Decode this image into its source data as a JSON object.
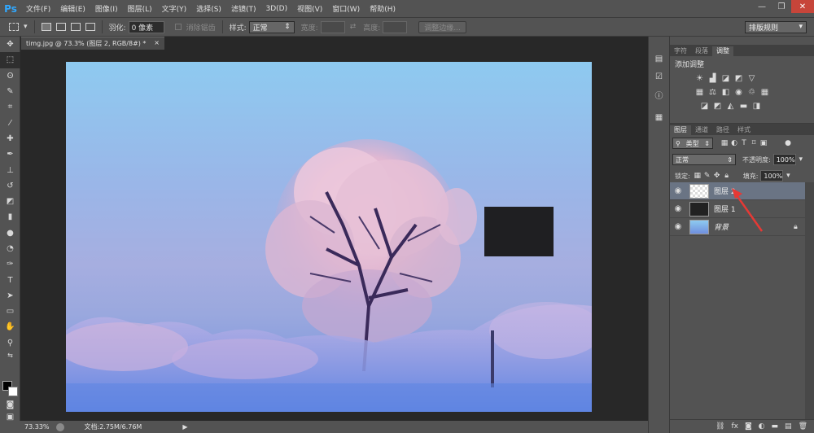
{
  "app": {
    "logo": "Ps"
  },
  "menu": [
    "文件(F)",
    "编辑(E)",
    "图像(I)",
    "图层(L)",
    "文字(Y)",
    "选择(S)",
    "滤镜(T)",
    "3D(D)",
    "视图(V)",
    "窗口(W)",
    "帮助(H)"
  ],
  "window_controls": {
    "minimize": "—",
    "restore": "❐",
    "close": "✕"
  },
  "options": {
    "feather_label": "羽化:",
    "feather_value": "0 像素",
    "antialias_label": "消除锯齿",
    "style_label": "样式:",
    "style_value": "正常",
    "width_label": "宽度:",
    "height_label": "高度:",
    "refine_edge_label": "调整边缘...",
    "workspace_value": "排版规则"
  },
  "document": {
    "tab_title": "timg.jpg @ 73.3% (图层 2, RGB/8#) *",
    "tab_close": "×",
    "zoom": "73.33%",
    "doc_info": "文档:2.75M/6.76M"
  },
  "top_panel": {
    "tabs": [
      "字符",
      "段落",
      "调整"
    ],
    "active_tab": "调整",
    "title": "添加调整"
  },
  "layers_panel": {
    "tabs": [
      "图层",
      "通道",
      "路径",
      "样式"
    ],
    "active_tab": "图层",
    "filter_kind": "类型",
    "blend_mode": "正常",
    "opacity_label": "不透明度:",
    "opacity_value": "100%",
    "lock_label": "锁定:",
    "fill_label": "填充:",
    "fill_value": "100%",
    "layers": [
      {
        "name": "图层 2",
        "selected": true
      },
      {
        "name": "图层 1",
        "selected": false
      },
      {
        "name": "背景",
        "selected": false,
        "locked": true
      }
    ]
  },
  "icons": [
    "move-icon",
    "marquee-icon",
    "lasso-icon",
    "quick-select-icon",
    "crop-icon",
    "eyedropper-icon",
    "healing-icon",
    "brush-icon",
    "stamp-icon",
    "history-brush-icon",
    "eraser-icon",
    "gradient-icon",
    "blur-icon",
    "dodge-icon",
    "pen-icon",
    "type-icon",
    "path-select-icon",
    "shape-icon",
    "hand-icon",
    "zoom-icon",
    "eye-icon",
    "lock-icon"
  ],
  "colors": {
    "accent_blue": "#31a8ff",
    "selected_layer": "#6a7484",
    "annotation_arrow": "#e53935"
  }
}
